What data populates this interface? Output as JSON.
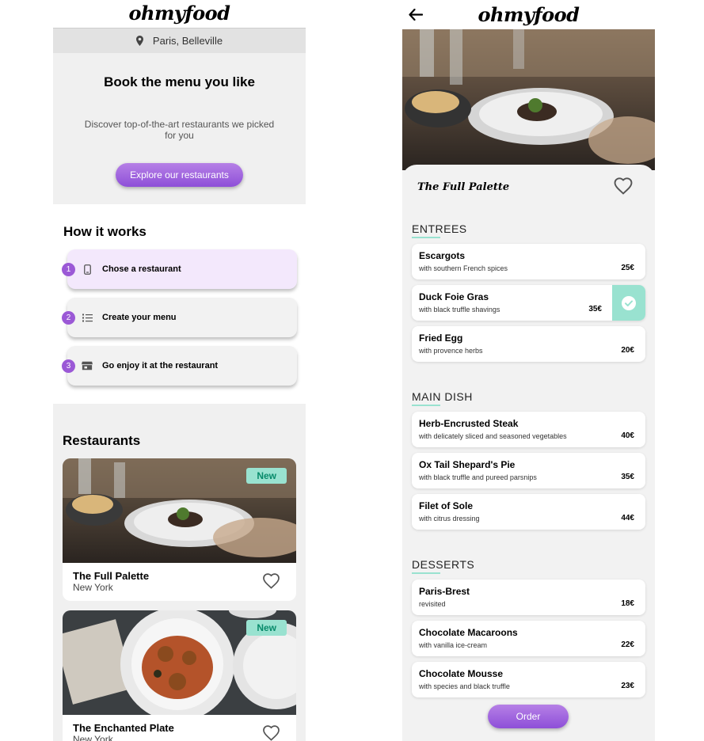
{
  "app": {
    "logo": "ohmyfood"
  },
  "home": {
    "location": "Paris, Belleville",
    "hero": {
      "title": "Book the menu you like",
      "subtitle": "Discover top-of-the-art restaurants we picked for you",
      "cta": "Explore our restaurants"
    },
    "how_it_works": {
      "title": "How it works",
      "steps": [
        {
          "num": "1",
          "label": "Chose a restaurant",
          "icon": "phone-icon",
          "active": true
        },
        {
          "num": "2",
          "label": "Create your menu",
          "icon": "list-icon",
          "active": false
        },
        {
          "num": "3",
          "label": "Go enjoy it at the restaurant",
          "icon": "store-icon",
          "active": false
        }
      ]
    },
    "restaurants": {
      "title": "Restaurants",
      "items": [
        {
          "name": "The Full Palette",
          "city": "New York",
          "badge": "New"
        },
        {
          "name": "The Enchanted Plate",
          "city": "New York",
          "badge": "New"
        }
      ]
    }
  },
  "menu": {
    "restaurant_name": "The Full Palette",
    "sections": [
      {
        "title": "ENTREES",
        "dishes": [
          {
            "name": "Escargots",
            "desc": "with southern French spices",
            "price": "25€",
            "selected": false
          },
          {
            "name": "Duck Foie Gras",
            "desc": "with black truffle shavings",
            "price": "35€",
            "selected": true
          },
          {
            "name": "Fried Egg",
            "desc": "with provence herbs",
            "price": "20€",
            "selected": false
          }
        ]
      },
      {
        "title": "MAIN DISH",
        "dishes": [
          {
            "name": "Herb-Encrusted Steak",
            "desc": "with delicately sliced and seasoned vegetables",
            "price": "40€",
            "selected": false
          },
          {
            "name": "Ox Tail Shepard's Pie",
            "desc": "with black truffle and pureed parsnips",
            "price": "35€",
            "selected": false
          },
          {
            "name": "Filet of Sole",
            "desc": "with citrus dressing",
            "price": "44€",
            "selected": false
          }
        ]
      },
      {
        "title": "DESSERTS",
        "dishes": [
          {
            "name": "Paris-Brest",
            "desc": "revisited",
            "price": "18€",
            "selected": false
          },
          {
            "name": "Chocolate Macaroons",
            "desc": "with vanilla ice-cream",
            "price": "22€",
            "selected": false
          },
          {
            "name": "Chocolate Mousse",
            "desc": "with species and black truffle",
            "price": "23€",
            "selected": false
          }
        ]
      }
    ],
    "order_label": "Order"
  },
  "colors": {
    "accent": "#9b59d6",
    "accent_light": "#f3e8fc",
    "mint": "#99e2d0",
    "mint_text": "#078a6a",
    "bg_grey": "#f0f0f0"
  }
}
